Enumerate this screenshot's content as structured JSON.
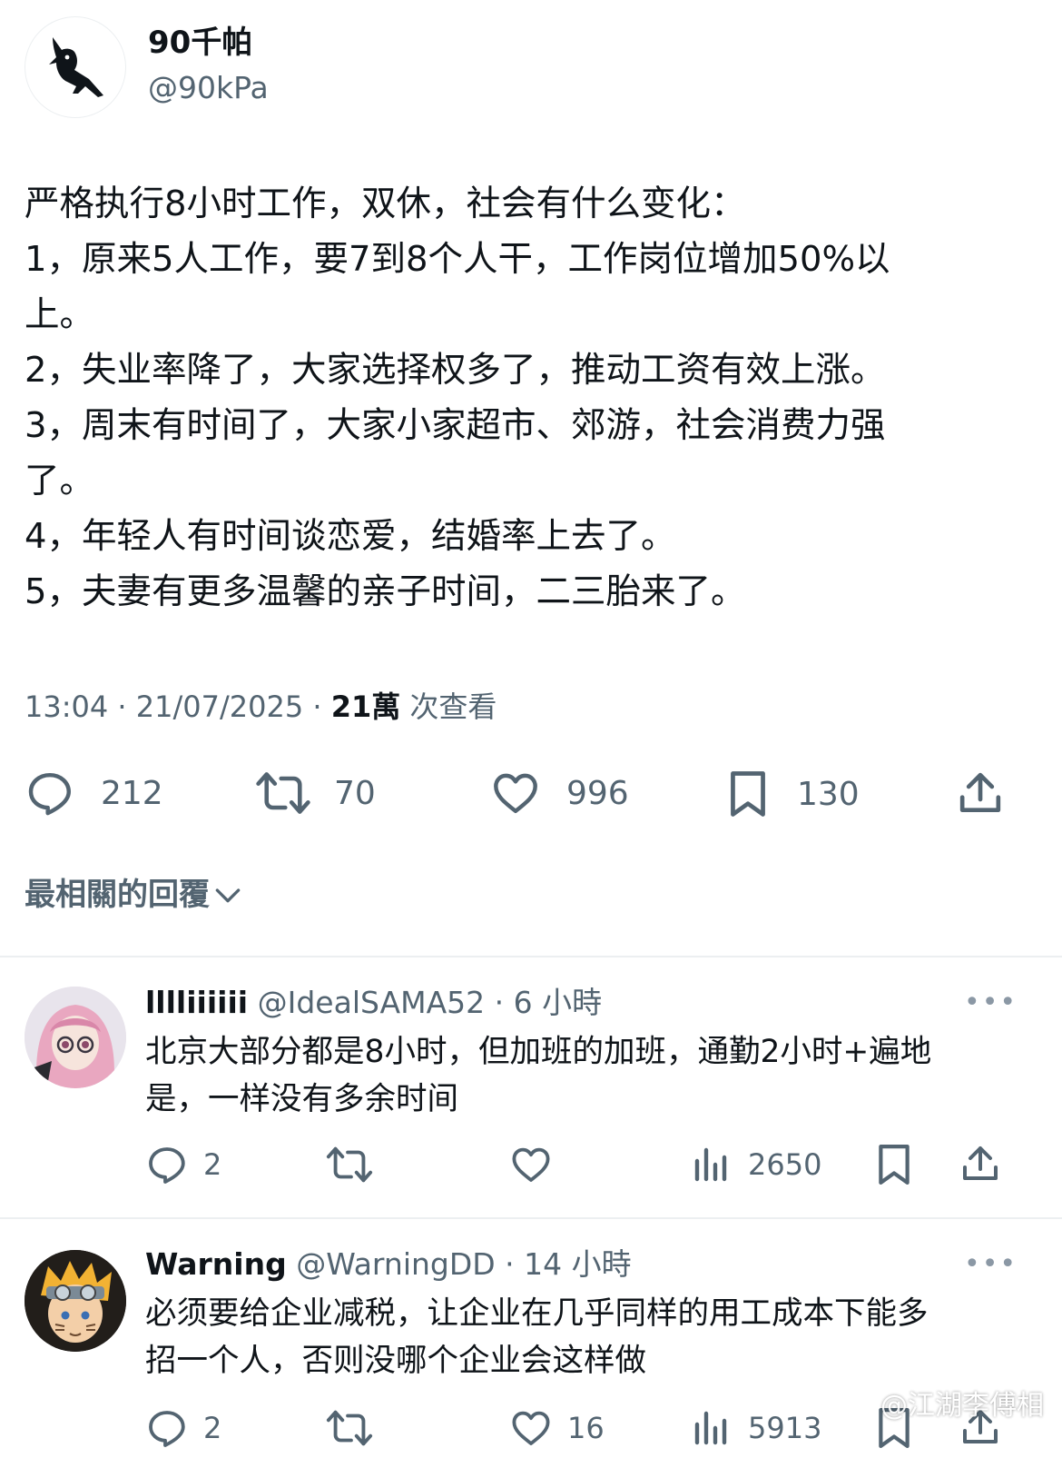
{
  "tweet": {
    "author_name": "90千帕",
    "author_handle": "@90kPa",
    "lines": [
      "严格执行8小时工作，双休，社会有什么变化：",
      "1，原来5人工作，要7到8个人干，工作岗位增加50%以",
      "上。",
      "2，失业率降了，大家选择权多了，推动工资有效上涨。",
      "3，周末有时间了，大家小家超市、郊游，社会消费力强",
      "了。",
      "4，年轻人有时间谈恋爱，结婚率上去了。",
      "5，夫妻有更多温馨的亲子时间，二三胎来了。"
    ],
    "time": "13:04",
    "date": "21/07/2025",
    "views": "21萬",
    "views_label": "次查看",
    "replies": "212",
    "retweets": "70",
    "likes": "996",
    "bookmarks": "130"
  },
  "replies_header": "最相關的回覆",
  "replies": [
    {
      "name": "lllliiiiii",
      "handle": "@IdealSAMA52",
      "time": "6 小時",
      "lines": [
        "北京大部分都是8小时，但加班的加班，通勤2小时+遍地",
        "是，一样没有多余时间"
      ],
      "reply_count": "2",
      "views": "2650"
    },
    {
      "name": "Warning",
      "handle": "@WarningDD",
      "time": "14 小時",
      "lines": [
        "必须要给企业减税，让企业在几乎同样的用工成本下能多",
        "招一个人，否则没哪个企业会这样做"
      ],
      "reply_count": "2",
      "likes": "16",
      "views": "5913"
    }
  ],
  "watermark": "@江湖李傅相",
  "colors": {
    "text": "#0f1419",
    "secondary": "#536471",
    "divider": "#eceff1",
    "background": "#ffffff"
  },
  "icons": [
    "bird-logo-icon",
    "reply-icon",
    "retweet-icon",
    "like-icon",
    "bookmark-icon",
    "share-icon",
    "views-icon",
    "chevron-down-icon",
    "more-icon",
    "weibo-icon"
  ]
}
